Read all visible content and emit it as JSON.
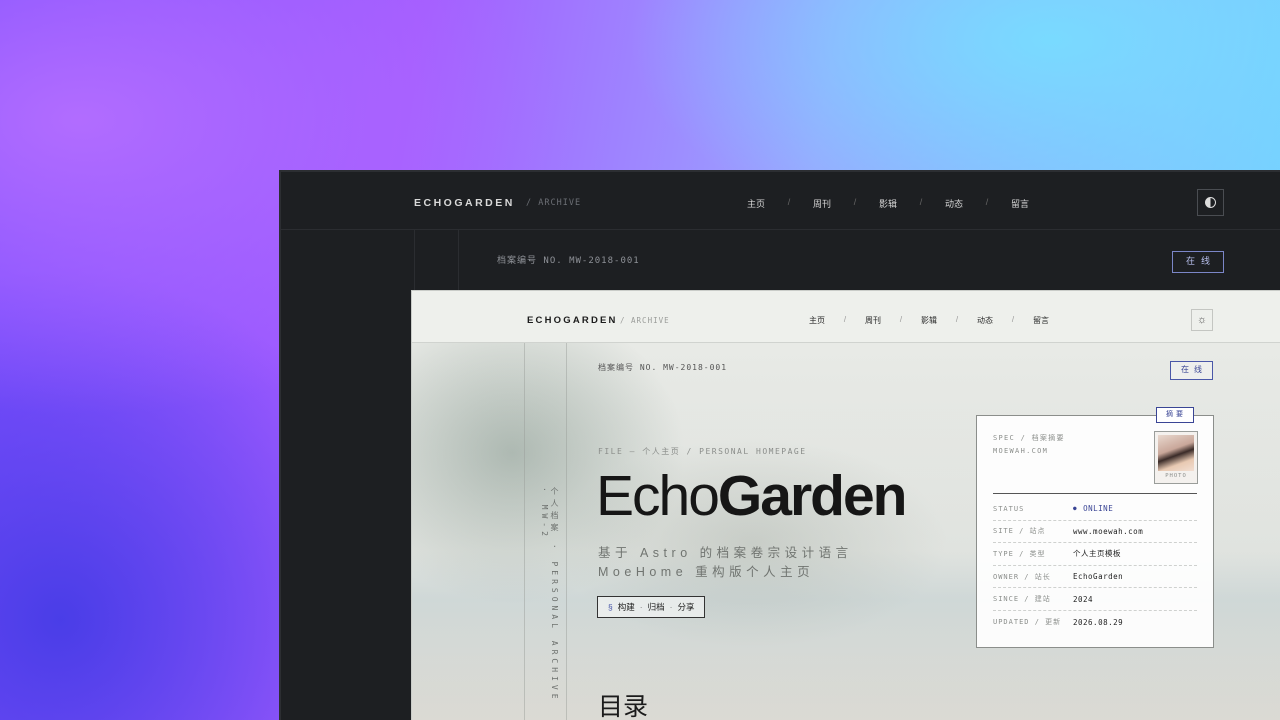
{
  "outer": {
    "brand": "ECHOGARDEN",
    "brand_sub": "/ ARCHIVE",
    "nav": [
      "主页",
      "周刊",
      "影辑",
      "动态",
      "留言"
    ],
    "nav_sep": "/",
    "theme_icon": "contrast-icon",
    "file_no": "档案编号 NO. MW-2018-001",
    "status_badge": "在线"
  },
  "inner": {
    "brand": "ECHOGARDEN",
    "brand_sub": "/ ARCHIVE",
    "nav": [
      "主页",
      "周刊",
      "影辑",
      "动态",
      "留言"
    ],
    "nav_sep": "/",
    "theme_icon": "sun-icon",
    "theme_glyph": "☼",
    "file_no": "档案编号 NO. MW-2018-001",
    "status_badge": "在线",
    "vertical_text": "个人档案 · PERSONAL ARCHIVE · MW-2",
    "file_label": "FILE — 个人主页 / PERSONAL HOMEPAGE",
    "title_light": "Echo",
    "title_bold": "Garden",
    "subtitle_line1": "基于 Astro 的档案卷宗设计语言",
    "subtitle_line2": "MoeHome 重构版个人主页",
    "tags": {
      "section": "§",
      "items": [
        "构建",
        "归档",
        "分享"
      ],
      "sep": "·"
    },
    "toc_heading": "目录"
  },
  "spec": {
    "badge": "摘要",
    "header1": "SPEC / 档案摘要",
    "header2": "MOEWAH.COM",
    "photo_caption": "PHOTO",
    "rows": [
      {
        "key": "STATUS",
        "value": "ONLINE"
      },
      {
        "key": "SITE / 站点",
        "value": "www.moewah.com"
      },
      {
        "key": "TYPE / 类型",
        "value": "个人主页模板"
      },
      {
        "key": "OWNER / 站长",
        "value": "EchoGarden"
      },
      {
        "key": "SINCE / 建站",
        "value": "2024"
      },
      {
        "key": "UPDATED / 更新",
        "value": "2026.08.29"
      }
    ]
  },
  "colors": {
    "accent": "#3a4595",
    "dark_bg": "#1d1f22",
    "light_bg": "#e6e8e3"
  }
}
